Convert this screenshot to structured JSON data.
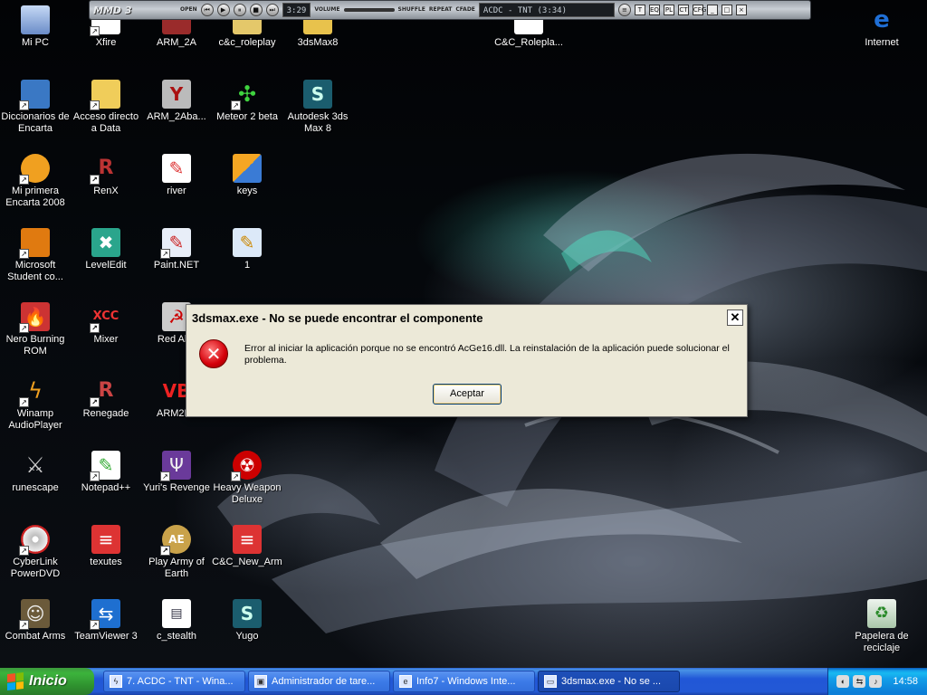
{
  "winamp": {
    "logo": "MMD 3",
    "open_label": "OPEN",
    "time": "3:29",
    "volume_label": "VOLUME",
    "shuffle_label": "SHUFFLE",
    "repeat_label": "REPEAT",
    "crossfade_label": "CFADE",
    "track": "ACDC - TNT (3:34)",
    "toggles": [
      "T",
      "EQ",
      "PL",
      "CT",
      "CFG"
    ]
  },
  "desktop_icons": [
    {
      "label": "Mi PC"
    },
    {
      "label": "Xfire"
    },
    {
      "label": "ARM_2A"
    },
    {
      "label": "c&c_roleplay"
    },
    {
      "label": "3dsMax8"
    },
    {
      "label": "C&C_Rolepla..."
    },
    {
      "label": "Internet"
    },
    {
      "label": "Diccionarios de Encarta"
    },
    {
      "label": "Acceso directo a Data"
    },
    {
      "label": "ARM_2Aba..."
    },
    {
      "label": "Meteor 2 beta"
    },
    {
      "label": "Autodesk 3ds Max 8"
    },
    {
      "label": "Mi primera Encarta 2008"
    },
    {
      "label": "RenX"
    },
    {
      "label": "river"
    },
    {
      "label": "keys"
    },
    {
      "label": "Microsoft Student co..."
    },
    {
      "label": "LevelEdit"
    },
    {
      "label": "Paint.NET"
    },
    {
      "label": "1"
    },
    {
      "label": "Nero Burning ROM"
    },
    {
      "label": "Mixer"
    },
    {
      "label": "Red Aler"
    },
    {
      "label": "Winamp AudioPlayer"
    },
    {
      "label": "Renegade"
    },
    {
      "label": "ARM2Be"
    },
    {
      "label": "runescape"
    },
    {
      "label": "Notepad++"
    },
    {
      "label": "Yuri's Revenge"
    },
    {
      "label": "Heavy Weapon Deluxe"
    },
    {
      "label": "CyberLink PowerDVD"
    },
    {
      "label": "texutes"
    },
    {
      "label": "Play Army of Earth"
    },
    {
      "label": "C&C_New_Arm"
    },
    {
      "label": "Combat Arms"
    },
    {
      "label": "TeamViewer 3"
    },
    {
      "label": "c_stealth"
    },
    {
      "label": "Yugo"
    },
    {
      "label": "Papelera de reciclaje"
    }
  ],
  "dialog": {
    "title": "3dsmax.exe - No se puede encontrar el componente",
    "close_glyph": "✕",
    "message": "Error al iniciar la aplicación porque no se encontró AcGe16.dll. La reinstalación de la aplicación puede solucionar el problema.",
    "ok_label": "Aceptar"
  },
  "taskbar": {
    "start_label": "Inicio",
    "tasks": [
      {
        "label": "7. ACDC - TNT - Wina..."
      },
      {
        "label": "Administrador de tare..."
      },
      {
        "label": "Info7 - Windows Inte..."
      },
      {
        "label": "3dsmax.exe - No se ..."
      }
    ],
    "clock": "14:58"
  }
}
